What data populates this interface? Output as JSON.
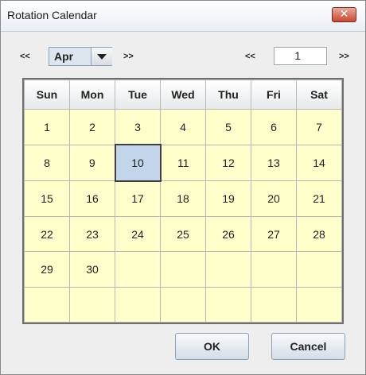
{
  "window": {
    "title": "Rotation Calendar",
    "close_symbol": "✕"
  },
  "nav": {
    "prev_month": "<<",
    "month": "Apr",
    "next_month": ">>",
    "prev_year": "<<",
    "year": "1",
    "next_year": ">>"
  },
  "calendar": {
    "weekdays": [
      "Sun",
      "Mon",
      "Tue",
      "Wed",
      "Thu",
      "Fri",
      "Sat"
    ],
    "weeks": [
      [
        "1",
        "2",
        "3",
        "4",
        "5",
        "6",
        "7"
      ],
      [
        "8",
        "9",
        "10",
        "11",
        "12",
        "13",
        "14"
      ],
      [
        "15",
        "16",
        "17",
        "18",
        "19",
        "20",
        "21"
      ],
      [
        "22",
        "23",
        "24",
        "25",
        "26",
        "27",
        "28"
      ],
      [
        "29",
        "30",
        "",
        "",
        "",
        "",
        ""
      ],
      [
        "",
        "",
        "",
        "",
        "",
        "",
        ""
      ]
    ],
    "selected_day": "10"
  },
  "buttons": {
    "ok": "OK",
    "cancel": "Cancel"
  },
  "colors": {
    "cell_bg": "#ffffcc",
    "selected_bg": "#c3d5ea",
    "close_bg": "#c9482f"
  },
  "icons": {
    "month_dropdown": "chevron-down-icon",
    "close": "close-icon"
  }
}
